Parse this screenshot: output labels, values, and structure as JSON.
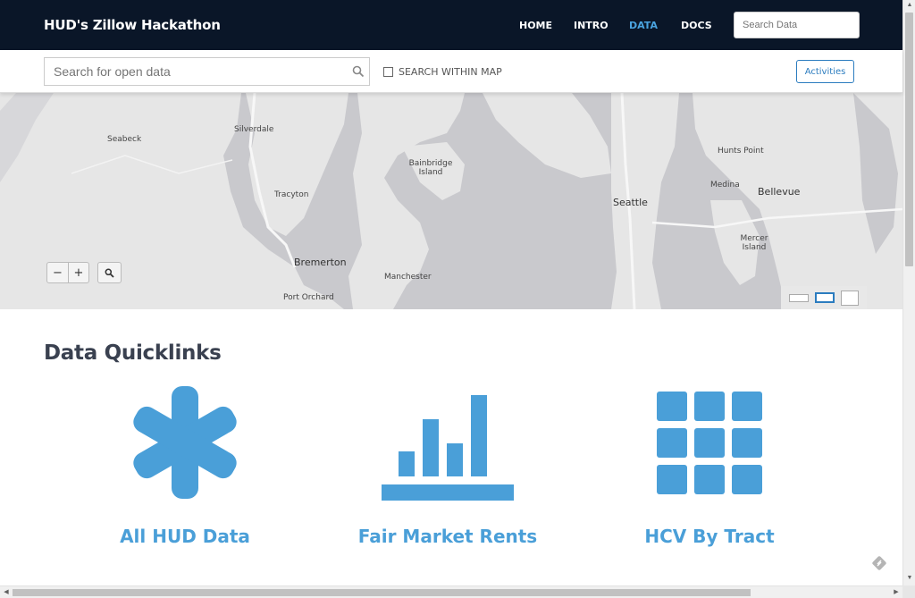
{
  "navbar": {
    "brand": "HUD's Zillow Hackathon",
    "links": [
      "HOME",
      "INTRO",
      "DATA",
      "DOCS"
    ],
    "active": "DATA",
    "search_placeholder": "Search Data"
  },
  "search": {
    "placeholder": "Search for open data",
    "within_map_label": "SEARCH WITHIN MAP",
    "activities_label": "Activities"
  },
  "map": {
    "labels": [
      "Seabeck",
      "Silverdale",
      "Bainbridge Island",
      "Tracyton",
      "Seattle",
      "Hunts Point",
      "Medina",
      "Bellevue",
      "Mercer Island",
      "Bremerton",
      "Manchester",
      "Port Orchard"
    ],
    "zoom_out": "−",
    "zoom_in": "+"
  },
  "quicklinks": {
    "title": "Data Quicklinks",
    "items": [
      {
        "label": "All HUD Data",
        "icon": "asterisk-icon"
      },
      {
        "label": "Fair Market Rents",
        "icon": "bar-chart-icon"
      },
      {
        "label": "HCV By Tract",
        "icon": "grid-icon"
      }
    ]
  },
  "colors": {
    "navbar_bg": "#0a1628",
    "accent": "#4a9fd8",
    "active_link": "#4aa3df",
    "map_water": "#c9c9cd",
    "map_land": "#e6e6e6"
  }
}
